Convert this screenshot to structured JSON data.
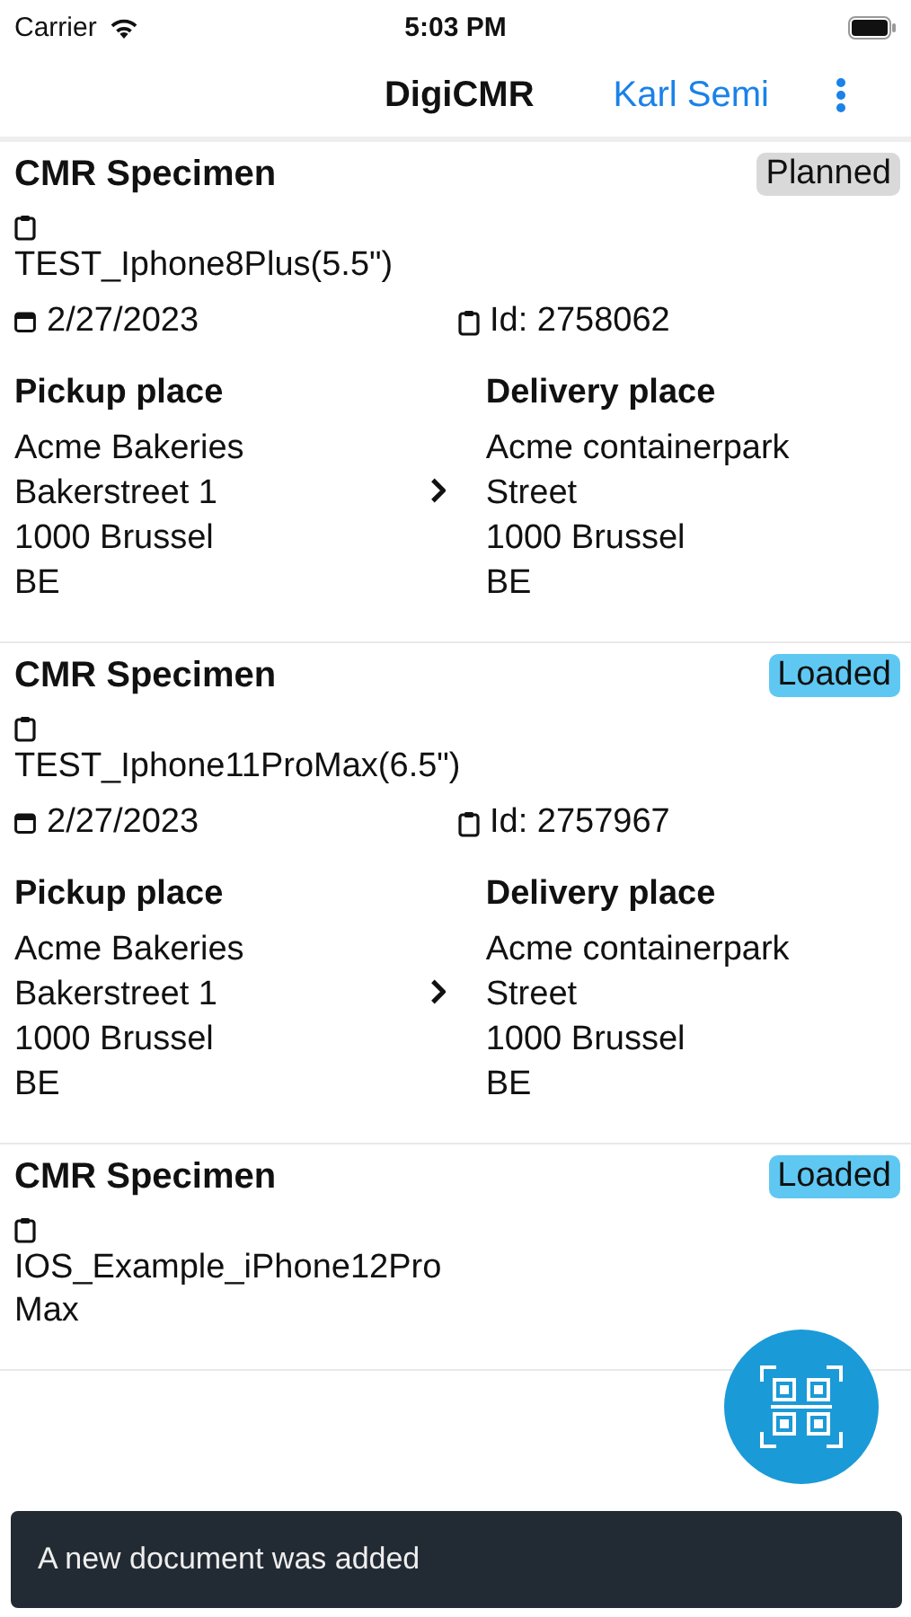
{
  "status_bar": {
    "carrier": "Carrier",
    "time": "5:03 PM"
  },
  "nav": {
    "title": "DigiCMR",
    "user": "Karl Semi"
  },
  "cards": [
    {
      "title": "CMR Specimen",
      "status": {
        "label": "Planned",
        "kind": "planned"
      },
      "name": "TEST_Iphone8Plus(5.5\")",
      "date": "2/27/2023",
      "id": "Id: 2758062",
      "pickup": {
        "heading": "Pickup place",
        "lines": [
          "Acme Bakeries",
          "Bakerstreet 1",
          "1000 Brussel",
          "BE"
        ]
      },
      "delivery": {
        "heading": "Delivery place",
        "lines": [
          "Acme containerpark",
          "Street",
          "1000 Brussel",
          "BE"
        ]
      }
    },
    {
      "title": "CMR Specimen",
      "status": {
        "label": "Loaded",
        "kind": "loaded"
      },
      "name": "TEST_Iphone11ProMax(6.5\")",
      "date": "2/27/2023",
      "id": "Id: 2757967",
      "pickup": {
        "heading": "Pickup place",
        "lines": [
          "Acme Bakeries",
          "Bakerstreet 1",
          "1000 Brussel",
          "BE"
        ]
      },
      "delivery": {
        "heading": "Delivery place",
        "lines": [
          "Acme containerpark",
          "Street",
          "1000 Brussel",
          "BE"
        ]
      }
    },
    {
      "title": "CMR Specimen",
      "status": {
        "label": "Loaded",
        "kind": "loaded"
      },
      "name": "IOS_Example_iPhone12ProMax"
    }
  ],
  "toast": "A new document was added"
}
